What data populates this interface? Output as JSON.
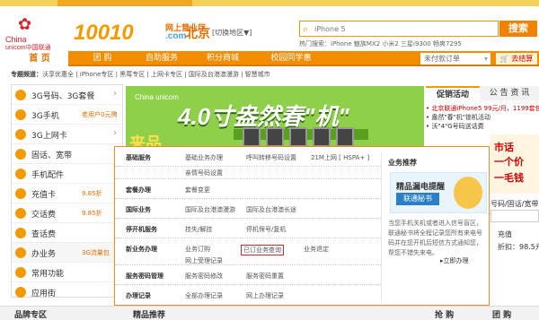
{
  "header": {
    "logo_cn": "China",
    "logo_en": "unicom中国联通",
    "brand_num": "10010",
    "brand_sub1": "网上营业厅",
    "brand_sub2": ".com",
    "city": "北京",
    "city_switch": "[切换地区▼]",
    "search_placeholder": "iPhone 5",
    "search_button": "搜索",
    "hot_words": "热门搜索：iPhone 魅族MX2 小米2 三星i9300 畅爽7295"
  },
  "nav": {
    "items": [
      "首  页",
      "团  购",
      "自助服务",
      "积分商城",
      "校园同学惠"
    ],
    "order": "未付款订单",
    "cart": "去结算"
  },
  "subnav": {
    "label": "专题频道：",
    "items": "沃享优惠全 | iPhone专区 | 黑莓专区 | 上网卡专区 | 国际及台港澳漫游 | 智慧城市"
  },
  "categories": [
    {
      "label": "3G号码、3G套餐",
      "promo": ""
    },
    {
      "label": "3G手机",
      "promo": "老用户0元购"
    },
    {
      "label": "3G上网卡",
      "promo": ""
    },
    {
      "label": "固话、宽带",
      "promo": ""
    },
    {
      "label": "手机配件",
      "promo": ""
    },
    {
      "label": "充值卡",
      "promo": "9.85折"
    },
    {
      "label": "交话费",
      "promo": "9.85折"
    },
    {
      "label": "查话费",
      "promo": ""
    },
    {
      "label": "办业务",
      "promo": "3G流量包"
    },
    {
      "label": "常用功能",
      "promo": ""
    },
    {
      "label": "应用街",
      "promo": ""
    }
  ],
  "banner": {
    "logo": "China unicom",
    "title": "4.0寸盎然春\"机\"",
    "sub": "来品"
  },
  "right": {
    "tab1": "促销活动",
    "tab2": "公 告 资 讯",
    "promos": [
      "• 北京联通iPhone5 99元/月，1199套包手机免费",
      "• 盎然\"春\"机\"锁机活动",
      "• 沃\"4\"G号码送话费"
    ],
    "ad_lines": [
      "市话",
      "一个价",
      "一分钟"
    ],
    "ad_tail": "一毛钱",
    "line1": "号码/固话/宽带充值",
    "input": "",
    "line2": "充值",
    "line3": "折扣：98.5元",
    "line4": ""
  },
  "popup": {
    "rows": [
      {
        "head": "基础服务",
        "vals": [
          [
            "基础业务办理",
            "呼叫转移号码设置",
            "21M上网 [ HSPA+ ]"
          ],
          [
            "亲情号码设置"
          ]
        ]
      },
      {
        "head": "套餐办理",
        "vals": [
          [
            "套餐变更"
          ]
        ]
      },
      {
        "head": "国际业务",
        "vals": [
          [
            "国际及台港澳漫游",
            "国际及台港澳长途"
          ]
        ]
      },
      {
        "head": "停开机服务",
        "vals": [
          [
            "挂失/解挂",
            "停机保号/复机"
          ]
        ]
      },
      {
        "head": "新业务办理",
        "vals": [
          [
            "业务订购",
            "已订业务查询",
            "业务退定"
          ],
          [
            "网上受理记录"
          ]
        ]
      },
      {
        "head": "服务密码管理",
        "vals": [
          [
            "服务密码修改",
            "服务密码重置"
          ]
        ]
      },
      {
        "head": "办理记录",
        "vals": [
          [
            "全部办理记录",
            "网上办理记录"
          ]
        ]
      }
    ],
    "side_title": "业务推荐",
    "side_ad": "精品漏电提醒",
    "side_ad_btn": "联通秘书",
    "side_desc": "当您手机关机或者进入信号盲区，联通秘书将全程记录您所有来电号码并在您开机后短信方式通知您，帮您不错失来电。",
    "side_go": "▸立即办理"
  },
  "bottom": {
    "left": "品牌专区",
    "mid": "精品推荐",
    "r1": "抢  购",
    "r2": "团  购"
  }
}
